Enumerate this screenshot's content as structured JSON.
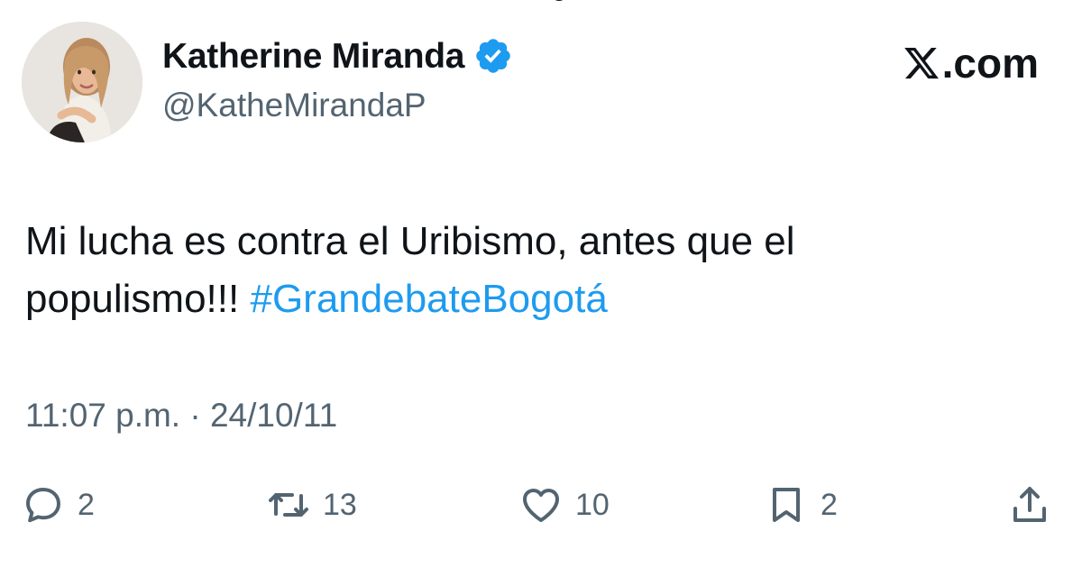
{
  "author": {
    "display_name": "Katherine Miranda",
    "handle": "@KatheMirandaP",
    "verified": true
  },
  "brand": {
    "site": ".com",
    "icon": "x-logo-icon"
  },
  "tweet": {
    "text": "Mi lucha es contra el Uribismo, antes que el populismo!!! ",
    "hashtag": "#GrandebateBogotá",
    "timestamp": "11:07 p.m. · 24/10/11"
  },
  "actions": {
    "replies": "2",
    "reposts": "13",
    "likes": "10",
    "bookmarks": "2"
  },
  "colors": {
    "text": "#0f1419",
    "secondary": "#536471",
    "accent": "#1d9bf0"
  }
}
